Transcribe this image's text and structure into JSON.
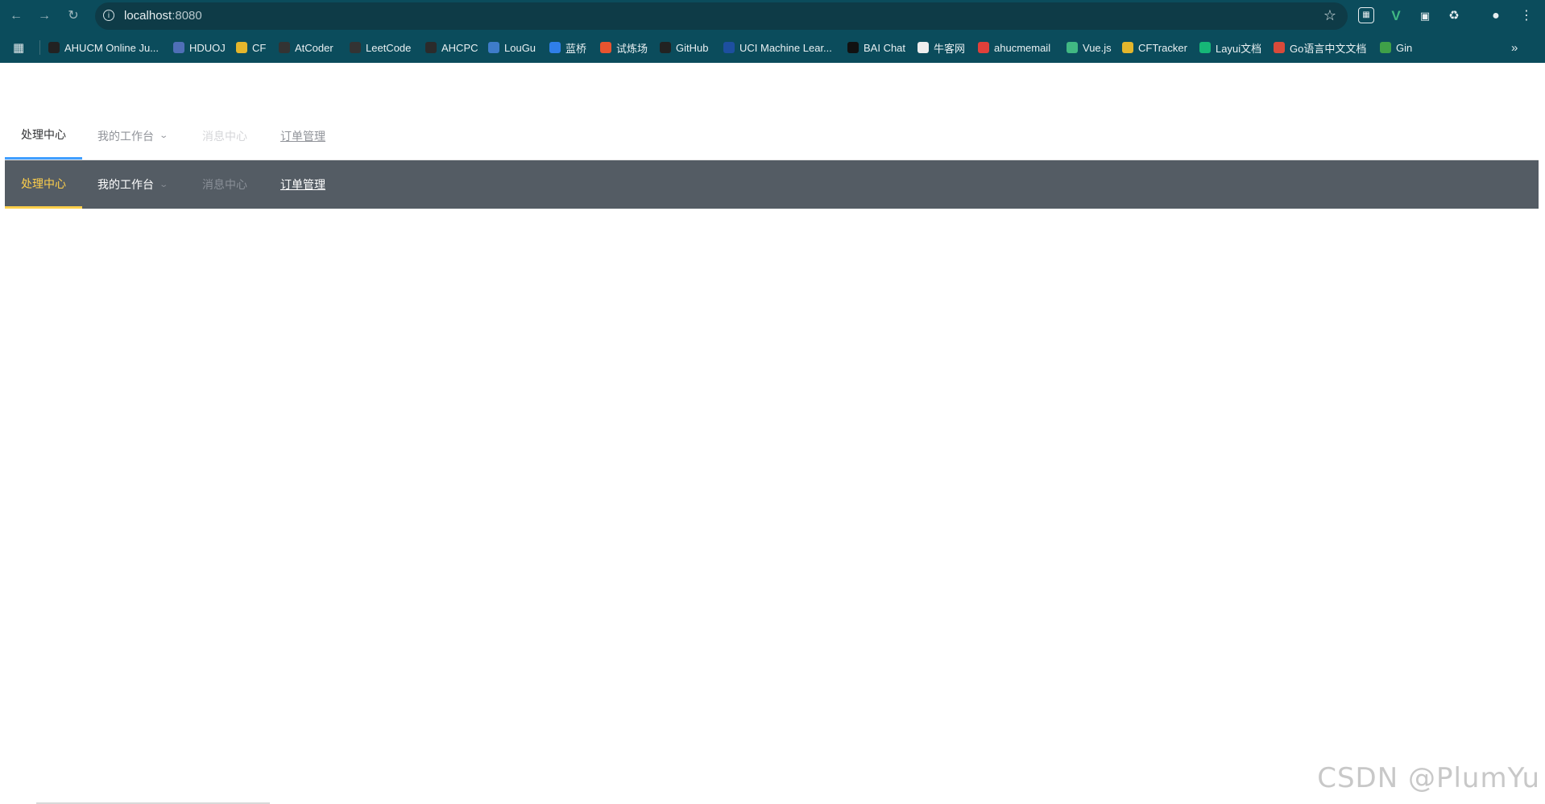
{
  "browser": {
    "url_host": "localhost",
    "url_port": ":8080",
    "bookmarks": [
      {
        "label": "AHUCM Online Ju...",
        "icon": "ahucm-icon",
        "color": "#222222"
      },
      {
        "label": "HDUOJ",
        "icon": "hduoj-icon",
        "color": "#4f6fb7"
      },
      {
        "label": "CF",
        "icon": "codeforces-icon",
        "color": "#e4b62c"
      },
      {
        "label": "AtCoder",
        "icon": "atcoder-icon",
        "color": "#333333"
      },
      {
        "label": "LeetCode",
        "icon": "leetcode-icon",
        "color": "#333333"
      },
      {
        "label": "AHCPC",
        "icon": "ahcpc-icon",
        "color": "#2b2b2b"
      },
      {
        "label": "LouGu",
        "icon": "luogu-icon",
        "color": "#3e7cc9"
      },
      {
        "label": "蓝桥",
        "icon": "lanqiao-icon",
        "color": "#2f7fe8"
      },
      {
        "label": "试炼场",
        "icon": "shilianchang-icon",
        "color": "#e8542f"
      },
      {
        "label": "GitHub",
        "icon": "github-icon",
        "color": "#222222"
      },
      {
        "label": "UCI Machine Lear...",
        "icon": "uci-icon",
        "color": "#1d4fa0"
      },
      {
        "label": "BAI Chat",
        "icon": "baichat-icon",
        "color": "#111111"
      },
      {
        "label": "牛客网",
        "icon": "nowcoder-icon",
        "color": "#eeeeee"
      },
      {
        "label": "ahucmemail",
        "icon": "email-icon",
        "color": "#e0403a"
      },
      {
        "label": "Vue.js",
        "icon": "vue-icon",
        "color": "#41b883"
      },
      {
        "label": "CFTracker",
        "icon": "cftracker-icon",
        "color": "#e4b62c"
      },
      {
        "label": "Layui文档",
        "icon": "layui-icon",
        "color": "#16b777"
      },
      {
        "label": "Go语言中文文档",
        "icon": "go-doc-icon",
        "color": "#d94a3a"
      },
      {
        "label": "Gin",
        "icon": "gin-icon",
        "color": "#3fa048"
      }
    ]
  },
  "menu_light": {
    "items": [
      {
        "label": "处理中心",
        "state": "active"
      },
      {
        "label": "我的工作台",
        "state": "submenu"
      },
      {
        "label": "消息中心",
        "state": "disabled"
      },
      {
        "label": "订单管理",
        "state": "link"
      }
    ],
    "active_color": "#409eff"
  },
  "menu_dark": {
    "items": [
      {
        "label": "处理中心",
        "state": "active"
      },
      {
        "label": "我的工作台",
        "state": "submenu"
      },
      {
        "label": "消息中心",
        "state": "disabled"
      },
      {
        "label": "订单管理",
        "state": "link"
      }
    ],
    "background": "#545c64",
    "active_color": "#ffd04b"
  },
  "watermark": "CSDN @PlumYu"
}
